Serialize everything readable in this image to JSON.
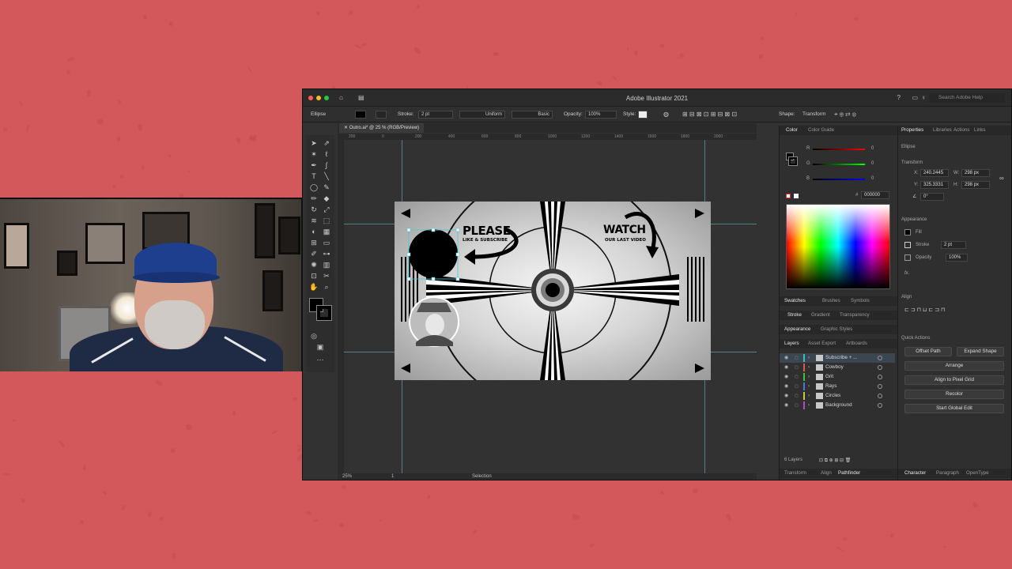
{
  "window": {
    "title": "Adobe Illustrator 2021",
    "search_placeholder": "Search Adobe Help",
    "doc_tab": "Outro.ai* @ 25 % (RGB/Preview)"
  },
  "control_bar": {
    "object_type": "Ellipse",
    "stroke_label": "Stroke:",
    "stroke_value": "2 pt",
    "stroke_profile": "Uniform",
    "brush": "Basic",
    "opacity_label": "Opacity:",
    "opacity_value": "100%",
    "style_label": "Style:",
    "shape_label": "Shape:",
    "transform_label": "Transform"
  },
  "artwork": {
    "please": "PLEASE",
    "please_sub": "LIKE & SUBSCRIBE",
    "watch": "WATCH",
    "watch_sub": "OUR LAST VIDEO"
  },
  "status_bar": {
    "zoom": "25%",
    "artboard_num": "1",
    "tool": "Selection"
  },
  "color_panel": {
    "tab_color": "Color",
    "tab_guide": "Color Guide",
    "r_label": "R",
    "g_label": "G",
    "b_label": "B",
    "r_value": "0",
    "g_value": "0",
    "b_value": "0",
    "hex_label": "#",
    "hex_value": "000000"
  },
  "swatch_tabs": [
    "Swatches",
    "Brushes",
    "Symbols"
  ],
  "stroke_tabs": [
    "Stroke",
    "Gradient",
    "Transparency"
  ],
  "appearance_tabs": [
    "Appearance",
    "Graphic Styles"
  ],
  "layers": {
    "tabs": [
      "Layers",
      "Asset Export",
      "Artboards"
    ],
    "items": [
      {
        "name": "Subscribe + ...",
        "color": "#2ec4c4",
        "selected": true
      },
      {
        "name": "Cowboy",
        "color": "#e0564f",
        "selected": false
      },
      {
        "name": "Grit",
        "color": "#3bc43b",
        "selected": false
      },
      {
        "name": "Rays",
        "color": "#4a78e0",
        "selected": false
      },
      {
        "name": "Circles",
        "color": "#c8c83a",
        "selected": false
      },
      {
        "name": "Background",
        "color": "#b44ac8",
        "selected": false
      }
    ],
    "count": "6 Layers"
  },
  "bottom_tabs": [
    "Transform",
    "Align",
    "Pathfinder"
  ],
  "properties": {
    "tabs": [
      "Properties",
      "Libraries",
      "Actions",
      "Links"
    ],
    "selection": "Ellipse",
    "transform_title": "Transform",
    "x_label": "X:",
    "x_value": "240.2445",
    "y_label": "Y:",
    "y_value": "325.3331",
    "w_label": "W:",
    "w_value": "298 px",
    "h_label": "H:",
    "h_value": "298 px",
    "angle_value": "0°",
    "appearance_title": "Appearance",
    "fill_label": "Fill",
    "stroke_label": "Stroke",
    "stroke_value": "2 pt",
    "opacity_label": "Opacity",
    "opacity_value": "100%",
    "fx_label": "fx.",
    "align_title": "Align",
    "quick_actions_title": "Quick Actions",
    "quick_actions": [
      "Offset Path",
      "Expand Shape",
      "Arrange",
      "Align to Pixel Grid",
      "Recolor",
      "Start Global Edit"
    ]
  },
  "char_tabs": [
    "Character",
    "Paragraph",
    "OpenType"
  ],
  "ruler_ticks": [
    "200",
    "0",
    "200",
    "400",
    "600",
    "800",
    "1000",
    "1200",
    "1400",
    "1600",
    "1800",
    "2000"
  ]
}
